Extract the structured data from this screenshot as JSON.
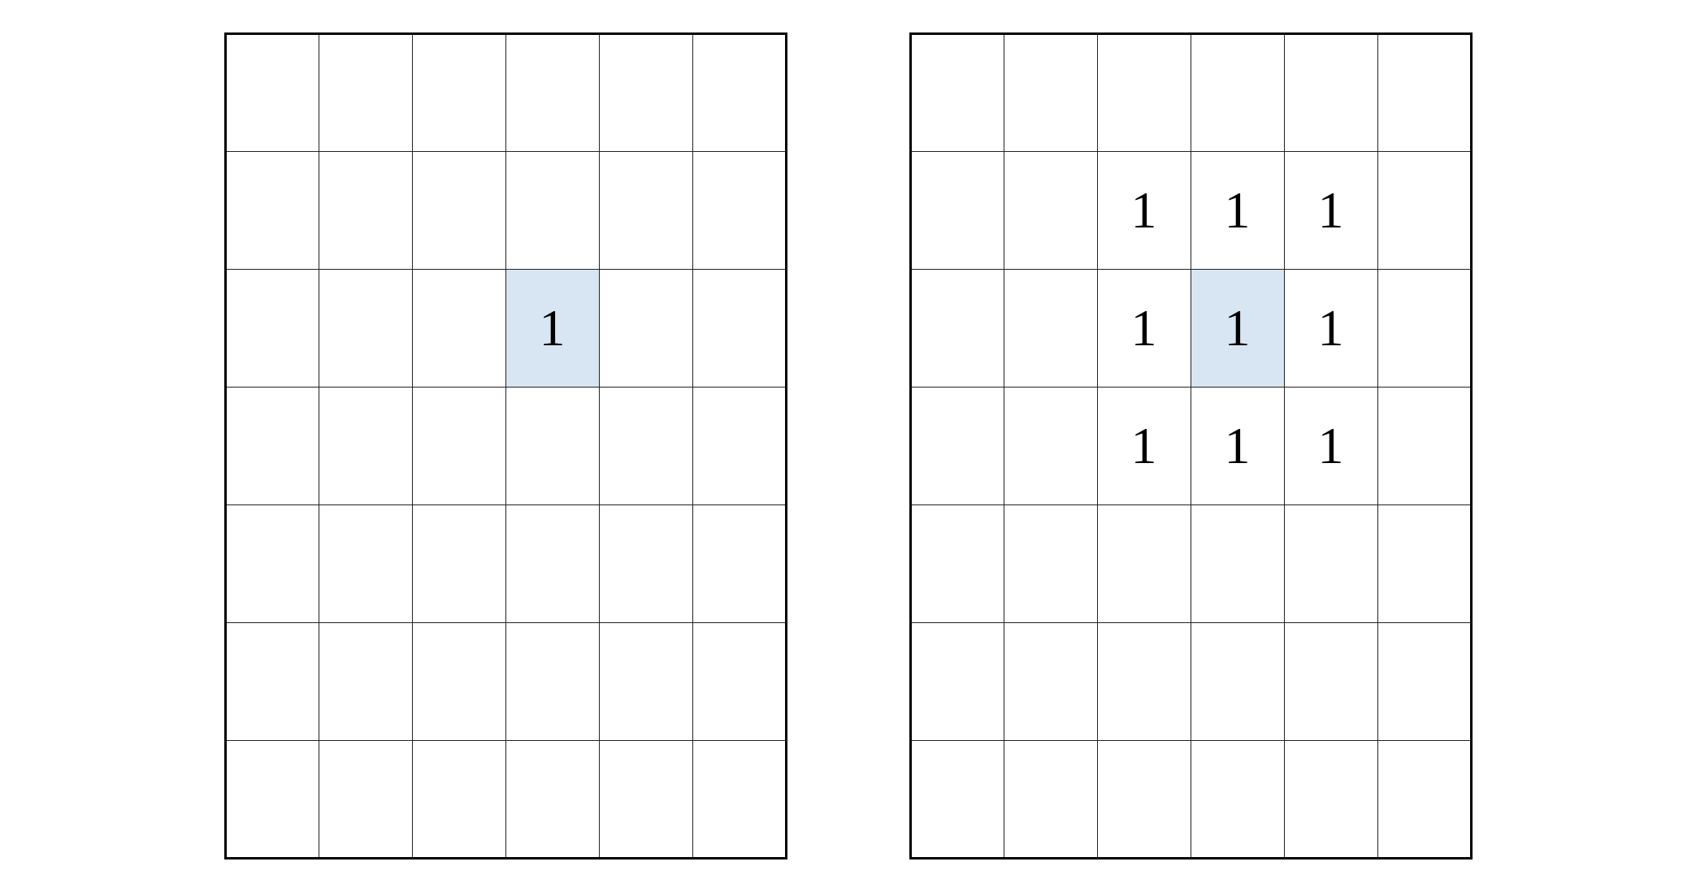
{
  "grids": {
    "rows": 7,
    "cols": 6,
    "highlight_color": "#d7e6f2",
    "left": {
      "cells": {
        "r2c3": {
          "value": "1",
          "hl": true
        }
      }
    },
    "right": {
      "cells": {
        "r1c2": {
          "value": "1"
        },
        "r1c3": {
          "value": "1"
        },
        "r1c4": {
          "value": "1"
        },
        "r2c2": {
          "value": "1"
        },
        "r2c3": {
          "value": "1",
          "hl": true
        },
        "r2c4": {
          "value": "1"
        },
        "r3c2": {
          "value": "1"
        },
        "r3c3": {
          "value": "1"
        },
        "r3c4": {
          "value": "1"
        }
      }
    }
  }
}
